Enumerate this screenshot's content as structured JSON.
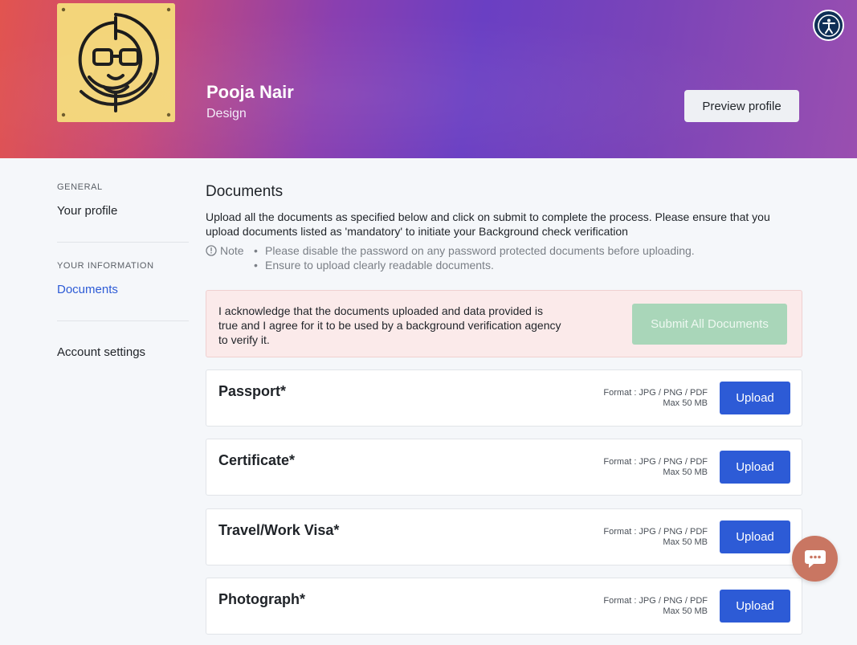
{
  "header": {
    "name": "Pooja Nair",
    "role": "Design",
    "preview_label": "Preview profile",
    "accessibility_icon": "accessibility-icon"
  },
  "sidebar": {
    "general_heading": "GENERAL",
    "your_profile": "Your profile",
    "info_heading": "YOUR INFORMATION",
    "documents": "Documents",
    "account_settings": "Account settings"
  },
  "main": {
    "title": "Documents",
    "description": "Upload all the documents as specified below and click on submit to complete the process. Please ensure that you upload documents listed as 'mandatory' to initiate your Background check verification",
    "note_label": "Note",
    "notes": [
      "Please disable the password on any password protected documents before uploading.",
      "Ensure to upload clearly readable documents."
    ],
    "ack_text": "I acknowledge that the documents uploaded and data provided is true and I agree for it to be used by a background verification agency to verify it.",
    "submit_label": "Submit All Documents",
    "documents": [
      {
        "name": "Passport*",
        "format": "Format : JPG / PNG / PDF",
        "max": "Max 50 MB",
        "upload": "Upload"
      },
      {
        "name": "Certificate*",
        "format": "Format : JPG / PNG / PDF",
        "max": "Max 50 MB",
        "upload": "Upload"
      },
      {
        "name": "Travel/Work Visa*",
        "format": "Format : JPG / PNG / PDF",
        "max": "Max 50 MB",
        "upload": "Upload"
      },
      {
        "name": "Photograph*",
        "format": "Format : JPG / PNG / PDF",
        "max": "Max 50 MB",
        "upload": "Upload"
      }
    ]
  },
  "colors": {
    "accent": "#2d5bd6",
    "submit_disabled": "#a9d6b9",
    "ack_bg": "#fbeaea",
    "chat": "#c97662"
  },
  "chat_icon": "chat-icon"
}
